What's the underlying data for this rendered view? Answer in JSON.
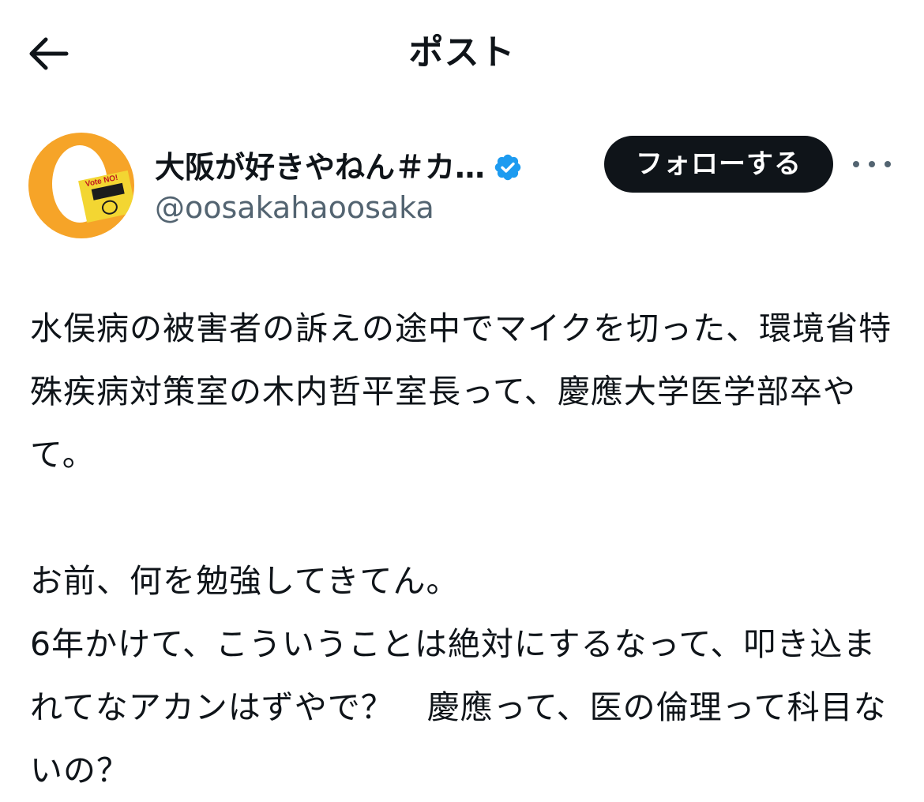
{
  "header": {
    "back_icon": "arrow-left-icon",
    "title": "ポスト"
  },
  "author": {
    "display_name": "大阪が好きやねん＃カ…",
    "handle": "@oosakahaoosaka",
    "verified_icon": "verified-badge-icon",
    "verified_color": "#1d9bf0",
    "avatar_bg": "#f6a428",
    "avatar_card_text": "Vote NO!"
  },
  "actions": {
    "follow_label": "フォローする",
    "more_icon": "more-horizontal-icon"
  },
  "post": {
    "paragraph1": "水俣病の被害者の訴えの途中でマイクを切った、環境省特殊疾病対策室の木内哲平室長って、慶應大学医学部卒やて。",
    "paragraph2": "お前、何を勉強してきてん。\n6年かけて、こういうことは絶対にするなって、叩き込まれてなアカンはずやで？　慶應って、医の倫理って科目ないの？"
  }
}
